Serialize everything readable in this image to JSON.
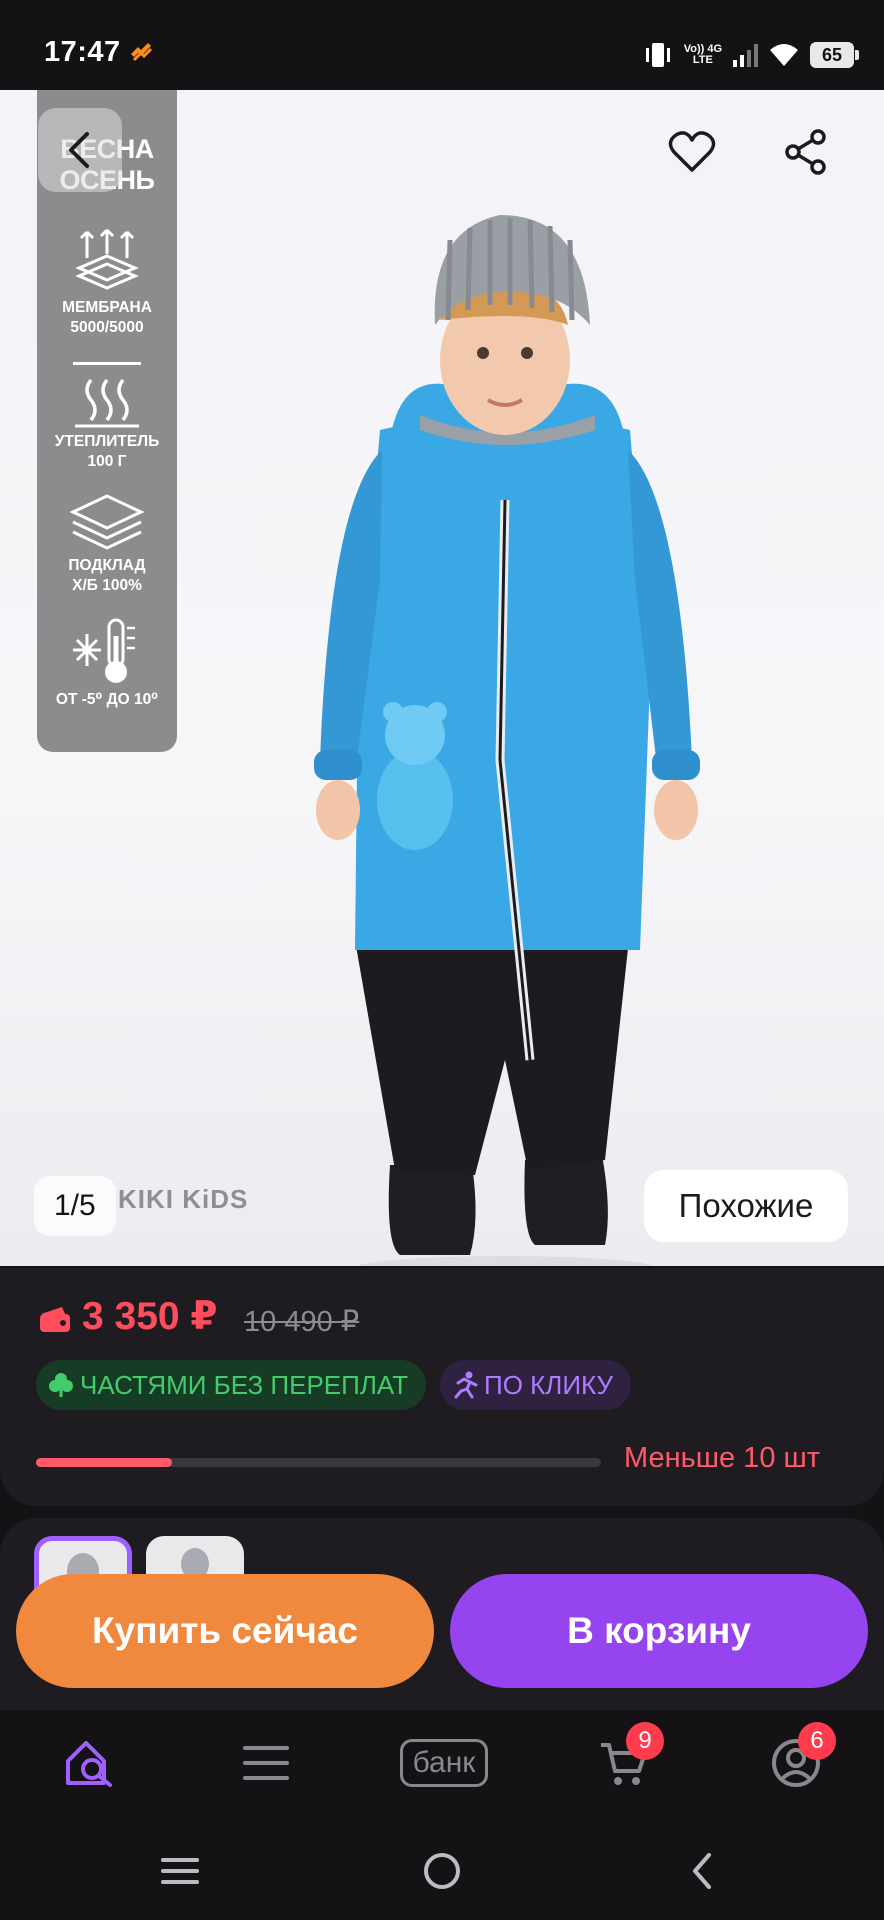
{
  "status_bar": {
    "time": "17:47",
    "network_top": "Vo)) 4G",
    "network_bottom": "LTE",
    "battery": "65"
  },
  "hero": {
    "season_line1": "ВЕСНА",
    "season_line2": "ОСЕНЬ",
    "features": [
      {
        "icon": "membrane-icon",
        "line1": "МЕМБРАНА",
        "line2": "5000/5000"
      },
      {
        "icon": "heat-icon",
        "line1": "УТЕПЛИТЕЛЬ",
        "line2": "100 Г"
      },
      {
        "icon": "layers-icon",
        "line1": "ПОДКЛАД",
        "line2": "Х/Б 100%"
      },
      {
        "icon": "thermometer-icon",
        "line1": "ОТ -5⁰ ДО 10⁰",
        "line2": ""
      }
    ],
    "page_counter": "1/5",
    "brand": "KIKI KiDS",
    "similar_label": "Похожие"
  },
  "product": {
    "price": "3 350 ₽",
    "old_price": "10 490 ₽",
    "badge_installments": "ЧАСТЯМИ БЕЗ ПЕРЕПЛАТ",
    "badge_one_click": "ПО КЛИКУ",
    "stock_label": "Меньше 10 шт",
    "stock_level": 0.24
  },
  "actions": {
    "buy_now": "Купить сейчас",
    "to_cart": "В корзину"
  },
  "bottom_nav": {
    "bank_label": "банк",
    "cart_count": "9",
    "profile_count": "6"
  },
  "colors": {
    "accent_purple": "#9544f0",
    "accent_orange": "#f0883d",
    "price_red": "#ff4d5e",
    "suit_blue": "#3aa8e4"
  }
}
